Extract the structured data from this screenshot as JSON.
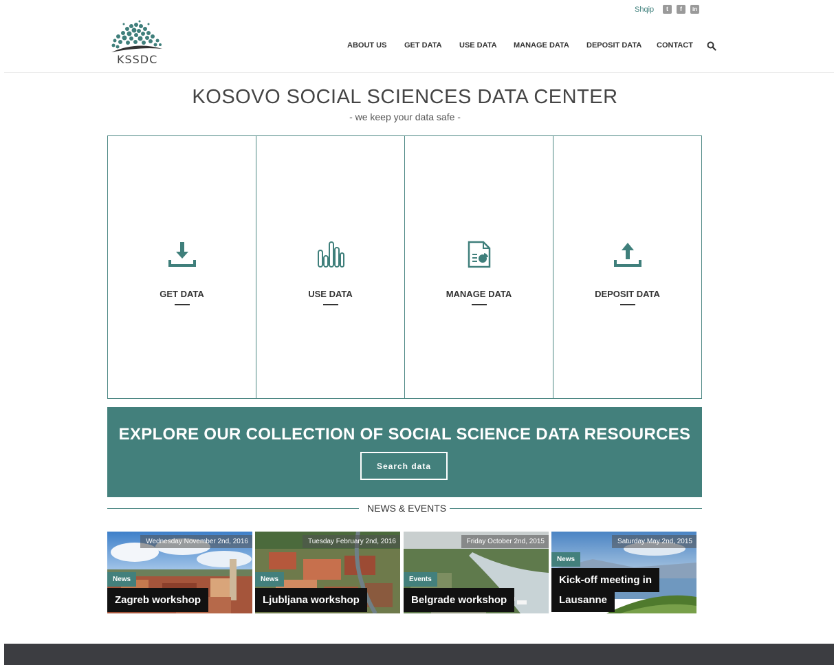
{
  "topbar": {
    "language": "Shqip",
    "social": [
      {
        "icon": "twitter-icon",
        "glyph": "t"
      },
      {
        "icon": "facebook-icon",
        "glyph": "f"
      },
      {
        "icon": "linkedin-icon",
        "glyph": "in"
      }
    ]
  },
  "header": {
    "logo_text": "KSSDC",
    "nav": [
      "ABOUT US",
      "GET DATA",
      "USE DATA",
      "MANAGE DATA",
      "DEPOSIT DATA",
      "CONTACT"
    ],
    "search_icon": "search-icon"
  },
  "hero": {
    "title": "KOSOVO SOCIAL SCIENCES DATA CENTER",
    "subtitle": "- we keep your data safe -"
  },
  "tiles": [
    {
      "label": "GET DATA",
      "icon": "download-icon"
    },
    {
      "label": "USE DATA",
      "icon": "bar-chart-icon"
    },
    {
      "label": "MANAGE DATA",
      "icon": "document-chart-icon"
    },
    {
      "label": "DEPOSIT DATA",
      "icon": "upload-icon"
    }
  ],
  "explore": {
    "title": "EXPLORE OUR COLLECTION OF SOCIAL SCIENCE DATA RESOURCES",
    "button": "Search data"
  },
  "news": {
    "heading": "NEWS & EVENTS",
    "items": [
      {
        "date": "Wednesday November 2nd, 2016",
        "tag": "News",
        "title": "Zagreb workshop"
      },
      {
        "date": "Tuesday February 2nd, 2016",
        "tag": "News",
        "title": "Ljubljana workshop"
      },
      {
        "date": "Friday October 2nd, 2015",
        "tag": "Events",
        "title": "Belgrade workshop"
      },
      {
        "date": "Saturday May 2nd, 2015",
        "tag": "News",
        "title_line1": "Kick-off meeting in",
        "title_line2": "Lausanne"
      }
    ]
  },
  "colors": {
    "accent": "#43807c",
    "footer": "#3c3d41"
  }
}
